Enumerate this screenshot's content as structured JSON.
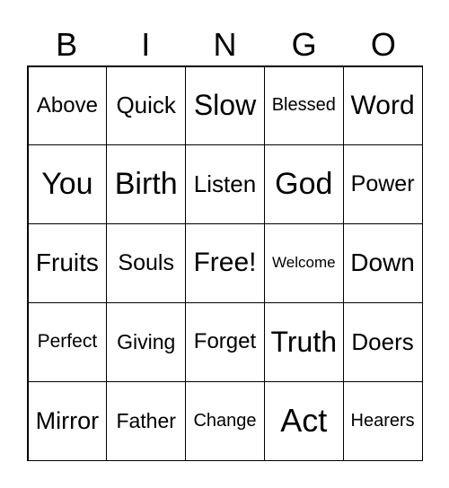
{
  "header": [
    "B",
    "I",
    "N",
    "G",
    "O"
  ],
  "cells": [
    [
      "Above",
      "Quick",
      "Slow",
      "Blessed",
      "Word"
    ],
    [
      "You",
      "Birth",
      "Listen",
      "God",
      "Power"
    ],
    [
      "Fruits",
      "Souls",
      "Free!",
      "Welcome",
      "Down"
    ],
    [
      "Perfect",
      "Giving",
      "Forget",
      "Truth",
      "Doers"
    ],
    [
      "Mirror",
      "Father",
      "Change",
      "Act",
      "Hearers"
    ]
  ]
}
